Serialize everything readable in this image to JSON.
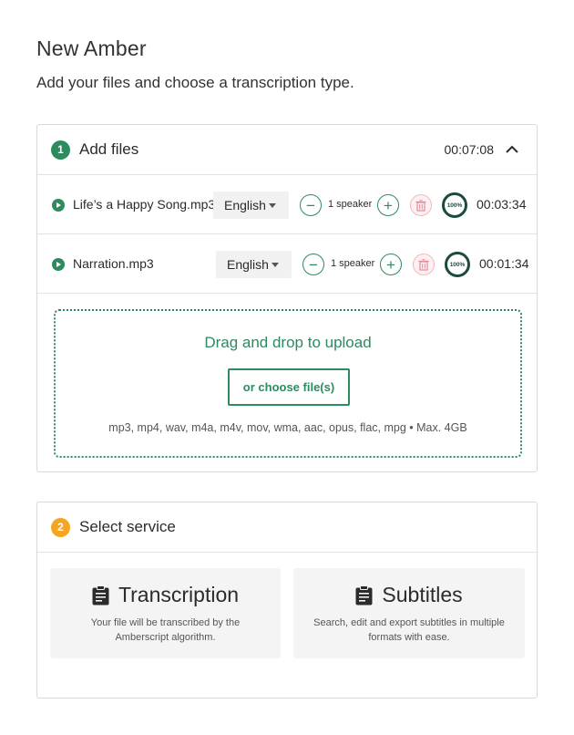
{
  "page": {
    "title": "New Amber",
    "subtitle": "Add your files and choose a transcription type."
  },
  "add_files": {
    "step": "1",
    "title": "Add files",
    "total_duration": "00:07:08",
    "files": [
      {
        "name": "Life’s a Happy Song.mp3",
        "language": "English",
        "speakers": "1 speaker",
        "progress": "100%",
        "duration": "00:03:34"
      },
      {
        "name": "Narration.mp3",
        "language": "English",
        "speakers": "1 speaker",
        "progress": "100%",
        "duration": "00:01:34"
      }
    ],
    "dropzone": {
      "title": "Drag and drop to upload",
      "button": "or choose file(s)",
      "formats": "mp3, mp4, wav, m4a, m4v, mov, wma, aac, opus, flac, mpg • Max. 4GB"
    }
  },
  "select_service": {
    "step": "2",
    "title": "Select service",
    "services": [
      {
        "title": "Transcription",
        "description": "Your file will be transcribed by the Amberscript algorithm.",
        "icon": "clipboard-icon"
      },
      {
        "title": "Subtitles",
        "description": "Search, edit and export subtitles in multiple formats with ease.",
        "icon": "clipboard-icon"
      }
    ]
  },
  "colors": {
    "accent": "#2e8a5f",
    "step2": "#f4a623",
    "progress": "#1d4a40",
    "delete": "#f3b7c0"
  }
}
